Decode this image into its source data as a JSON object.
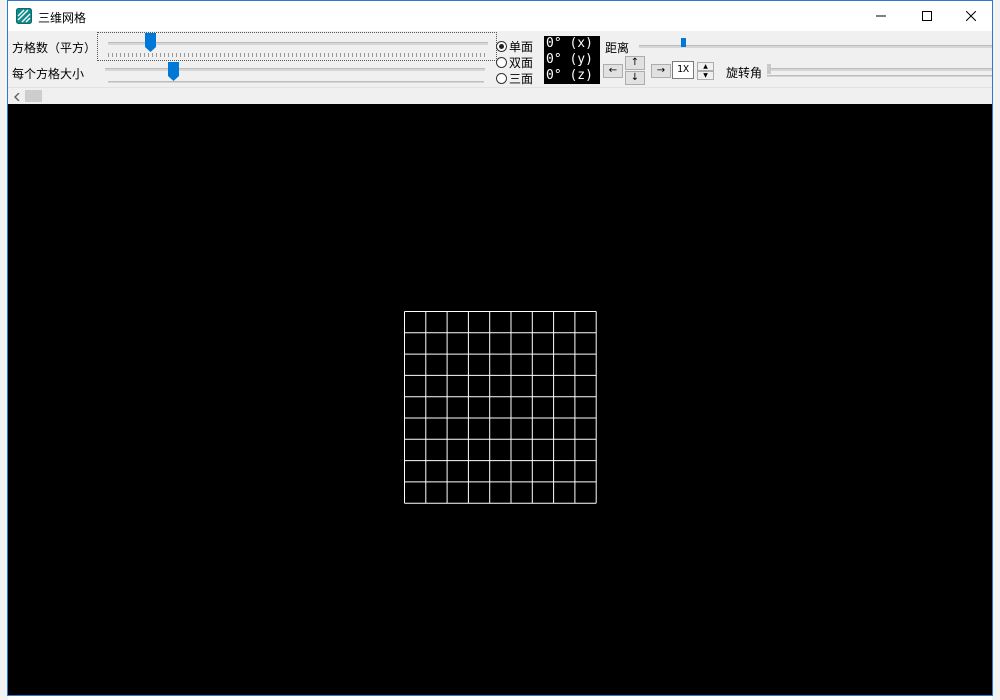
{
  "window": {
    "title": "三维网格",
    "app_icon": "app-grid-icon",
    "controls": [
      "minimize-icon",
      "maximize-icon",
      "close-icon"
    ]
  },
  "controls": {
    "grid_count_label": "方格数（平方）",
    "grid_count_level": 0.1,
    "cell_size_label": "每个方格大小",
    "cell_size_level": 0.17,
    "faces": {
      "options": [
        "单面",
        "双面",
        "三面"
      ],
      "selected": "单面"
    },
    "angles": [
      "0° (x)",
      "0° (y)",
      "0° (z)"
    ],
    "distance_label": "距离",
    "distance_level": 0.12,
    "rotation_label": "旋转角",
    "rotation_level": 0.0,
    "arrows": {
      "up": "↑",
      "down": "↓",
      "left": "←",
      "right": "→"
    },
    "zoom_value": "1X"
  },
  "grid": {
    "columns": 9,
    "rows": 9,
    "line_color": "#ffffff",
    "background": "#000000"
  },
  "colors": {
    "accent": "#0078d7",
    "window_border": "#2b79d0"
  }
}
